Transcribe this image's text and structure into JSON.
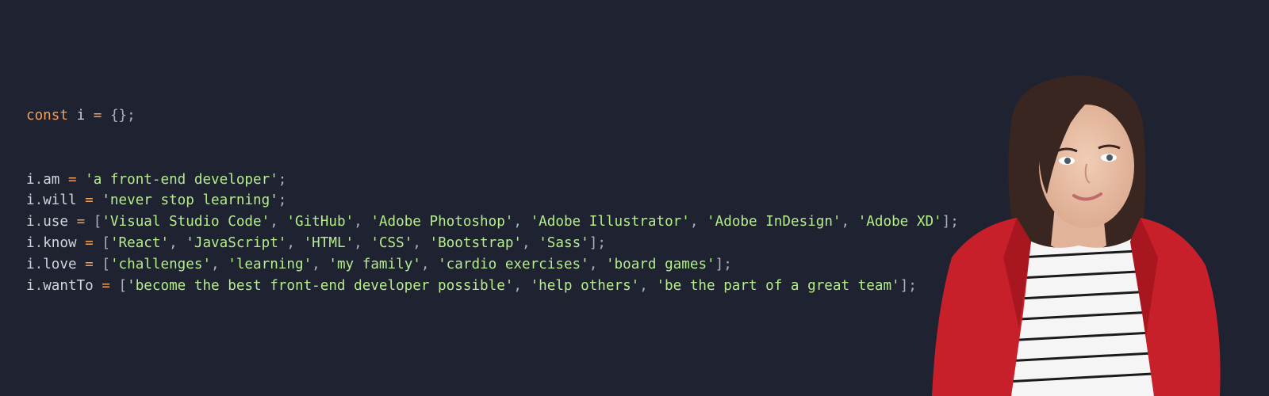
{
  "code": {
    "keyword_const": "const",
    "object_name": "i",
    "assign": "=",
    "empty_object": "{}",
    "semicolon": ";",
    "dot": ".",
    "open_bracket": "[",
    "close_bracket": "]",
    "comma": ",",
    "lines": [
      {
        "prop": "am",
        "value": "'a front-end developer'"
      },
      {
        "prop": "will",
        "value": "'never stop learning'"
      },
      {
        "prop": "use",
        "items": [
          "'Visual Studio Code'",
          "'GitHub'",
          "'Adobe Photoshop'",
          "'Adobe Illustrator'",
          "'Adobe InDesign'",
          "'Adobe XD'"
        ]
      },
      {
        "prop": "know",
        "items": [
          "'React'",
          "'JavaScript'",
          "'HTML'",
          "'CSS'",
          "'Bootstrap'",
          "'Sass'"
        ]
      },
      {
        "prop": "love",
        "items": [
          "'challenges'",
          "'learning'",
          "'my family'",
          "'cardio exercises'",
          "'board games'"
        ]
      },
      {
        "prop": "wantTo",
        "items": [
          "'become the best front-end developer possible'",
          "'help others'",
          "'be the part of a great team'"
        ]
      }
    ]
  },
  "colors": {
    "background": "#1f2230",
    "keyword": "#f2a05c",
    "string": "#b5ed8d",
    "identifier": "#d1d5db",
    "punctuation": "#aab2bd",
    "jacket": "#c8202a",
    "hair": "#3a2621"
  }
}
